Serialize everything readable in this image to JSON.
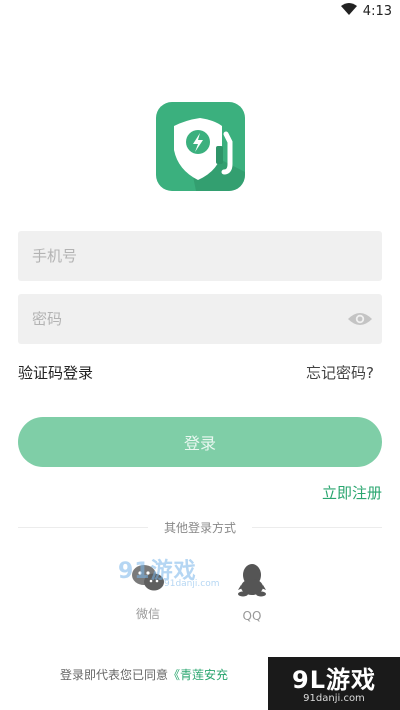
{
  "status_bar": {
    "time": "4:13"
  },
  "login_form": {
    "phone_placeholder": "手机号",
    "password_placeholder": "密码",
    "sms_login_label": "验证码登录",
    "forgot_password_label": "忘记密码?",
    "login_button_label": "登录",
    "register_label": "立即注册"
  },
  "other_login": {
    "divider_label": "其他登录方式",
    "wechat_label": "微信",
    "qq_label": "QQ"
  },
  "agreement": {
    "prefix": "登录即代表您已同意",
    "link_fragment": "《青莲安充"
  },
  "watermarks": {
    "top_brand": "91游戏",
    "top_url": "91danji.com",
    "corner_brand": "9L游戏",
    "corner_url": "91danji.com"
  },
  "colors": {
    "brand_green": "#3bb07e",
    "button_green": "#7fcea7",
    "link_green": "#2aa66f",
    "input_bg": "#f0f0f0"
  }
}
